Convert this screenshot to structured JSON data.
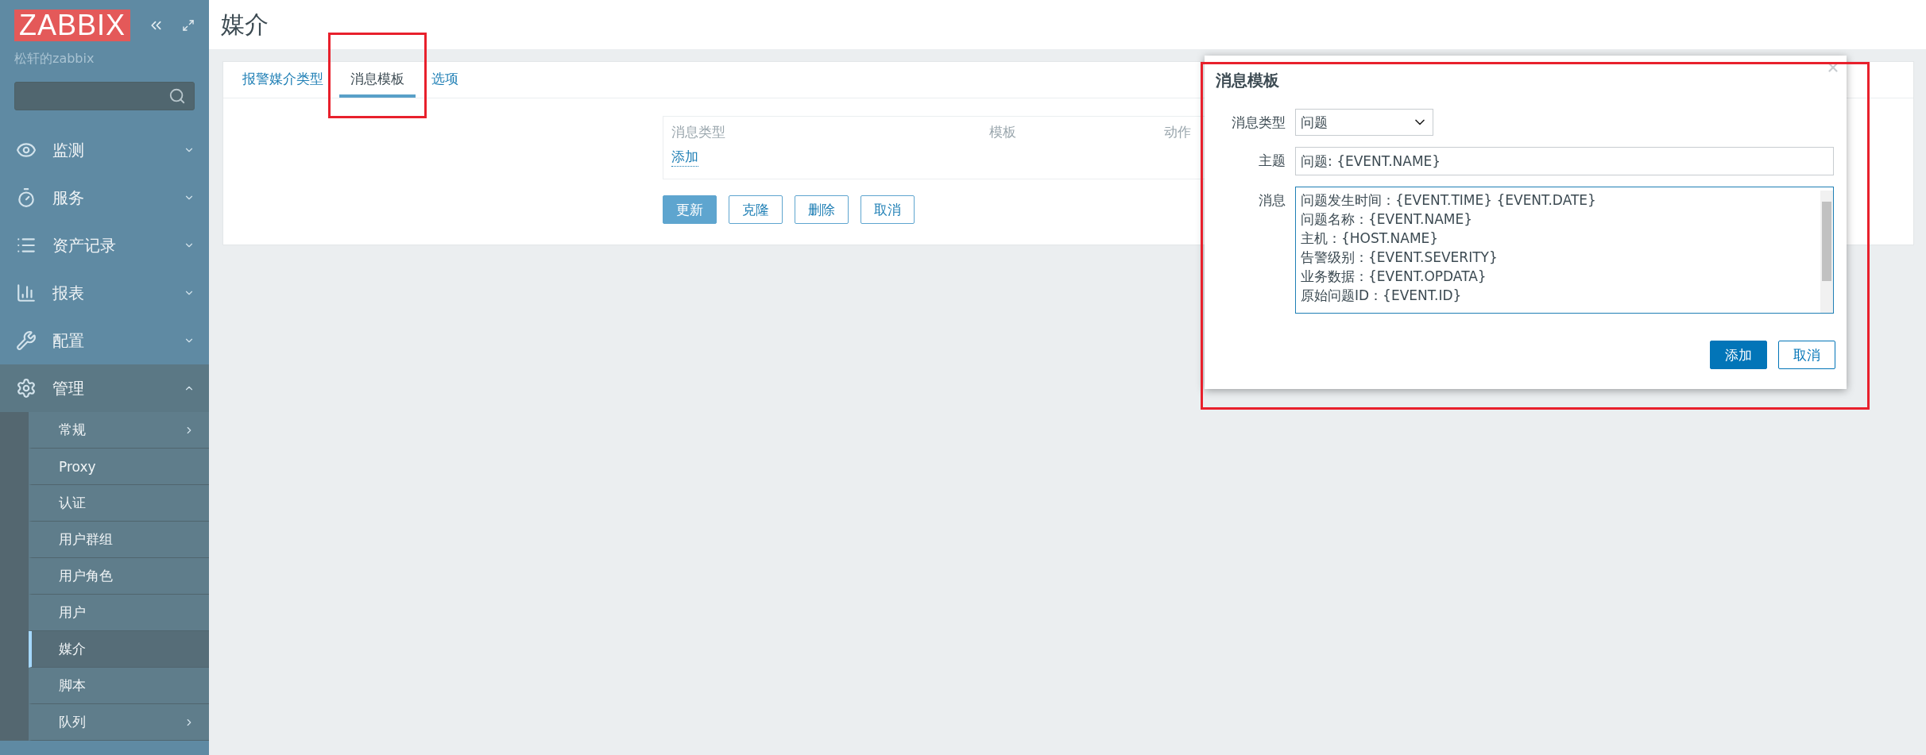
{
  "sidebar": {
    "logo": "ZABBIX",
    "server_name": "松轩的zabbix",
    "menu": [
      {
        "label": "监测",
        "expanded": false
      },
      {
        "label": "服务",
        "expanded": false
      },
      {
        "label": "资产记录",
        "expanded": false
      },
      {
        "label": "报表",
        "expanded": false
      },
      {
        "label": "配置",
        "expanded": false
      },
      {
        "label": "管理",
        "expanded": true,
        "children": [
          {
            "label": "常规",
            "selected": false,
            "has_submenu": true
          },
          {
            "label": "Proxy",
            "selected": false,
            "has_submenu": false
          },
          {
            "label": "认证",
            "selected": false,
            "has_submenu": false
          },
          {
            "label": "用户群组",
            "selected": false,
            "has_submenu": false
          },
          {
            "label": "用户角色",
            "selected": false,
            "has_submenu": false
          },
          {
            "label": "用户",
            "selected": false,
            "has_submenu": false
          },
          {
            "label": "媒介",
            "selected": true,
            "has_submenu": false
          },
          {
            "label": "脚本",
            "selected": false,
            "has_submenu": false
          },
          {
            "label": "队列",
            "selected": false,
            "has_submenu": true
          }
        ]
      }
    ]
  },
  "page_title": "媒介",
  "tabs": [
    {
      "label": "报警媒介类型",
      "selected": false,
      "highlighted": false
    },
    {
      "label": "消息模板",
      "selected": true,
      "highlighted": true
    },
    {
      "label": "选项",
      "selected": false,
      "highlighted": false
    }
  ],
  "table": {
    "columns": [
      "消息类型",
      "模板",
      "动作"
    ],
    "add_link": "添加"
  },
  "buttons": [
    {
      "label": "更新",
      "primary": true
    },
    {
      "label": "克隆",
      "primary": false
    },
    {
      "label": "删除",
      "primary": false
    },
    {
      "label": "取消",
      "primary": false
    }
  ],
  "dialog": {
    "title": "消息模板",
    "highlighted": true,
    "fields": [
      {
        "label": "消息类型",
        "kind": "select",
        "value": "问题"
      },
      {
        "label": "主题",
        "kind": "text",
        "value": "问题: {EVENT.NAME}"
      },
      {
        "label": "消息",
        "kind": "textarea",
        "lines": [
          "问题发生时间：{EVENT.TIME} {EVENT.DATE}",
          "问题名称：{EVENT.NAME}",
          "主机：{HOST.NAME}",
          "告警级别：{EVENT.SEVERITY}",
          "业务数据：{EVENT.OPDATA}",
          "原始问题ID：{EVENT.ID}"
        ]
      }
    ],
    "buttons": [
      {
        "label": "添加",
        "primary": true
      },
      {
        "label": "取消",
        "primary": false
      }
    ]
  }
}
